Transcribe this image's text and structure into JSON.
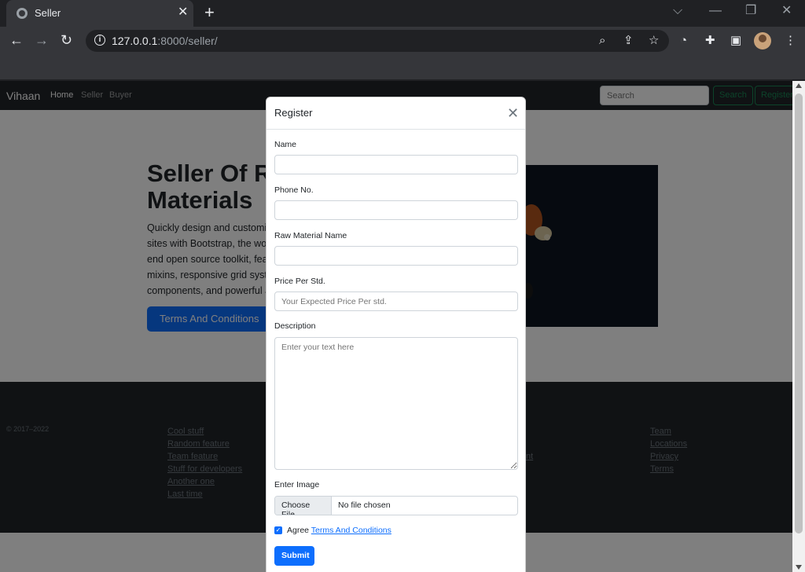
{
  "browser": {
    "tab_title": "Seller",
    "tab_close": "✕",
    "new_tab": "+",
    "url_host": "127.0.0.1",
    "url_rest": ":8000/seller/",
    "window_controls": [
      "⌵",
      "—",
      "❐",
      "✕"
    ]
  },
  "navbar": {
    "brand": "Vihaan",
    "links": [
      "Home",
      "Seller",
      "Buyer"
    ],
    "search_placeholder": "Search",
    "search_button": "Search",
    "register_button": "Register"
  },
  "hero": {
    "title": "Seller Of Raw Materials",
    "lead": "Quickly design and customize responsive mobile-first sites with Bootstrap, the world's most popular front-end open source toolkit, featuring Sass variables and mixins, responsive grid system, extensive prebuilt components, and powerful JavaScript plugins.",
    "button": "Terms And Conditions"
  },
  "footer": {
    "copyright": "© 2017–2022",
    "columns": [
      [
        "Cool stuff",
        "Random feature",
        "Team feature",
        "Stuff for developers",
        "Another one",
        "Last time"
      ],
      [
        "Team",
        "Locations",
        "Privacy",
        "Terms"
      ]
    ],
    "partial_link": "nt"
  },
  "modal": {
    "title": "Register",
    "close": "✕",
    "fields": {
      "name_label": "Name",
      "phone_label": "Phone No.",
      "material_label": "Raw Material Name",
      "price_label": "Price Per Std.",
      "price_placeholder": "Your Expected Price Per std.",
      "description_label": "Description",
      "description_placeholder": "Enter your text here",
      "image_label": "Enter Image",
      "file_button": "Choose File",
      "file_status": "No file chosen"
    },
    "agree_text": "Agree",
    "agree_link": "Terms And Conditions",
    "agree_checked": true,
    "submit": "Submit"
  }
}
